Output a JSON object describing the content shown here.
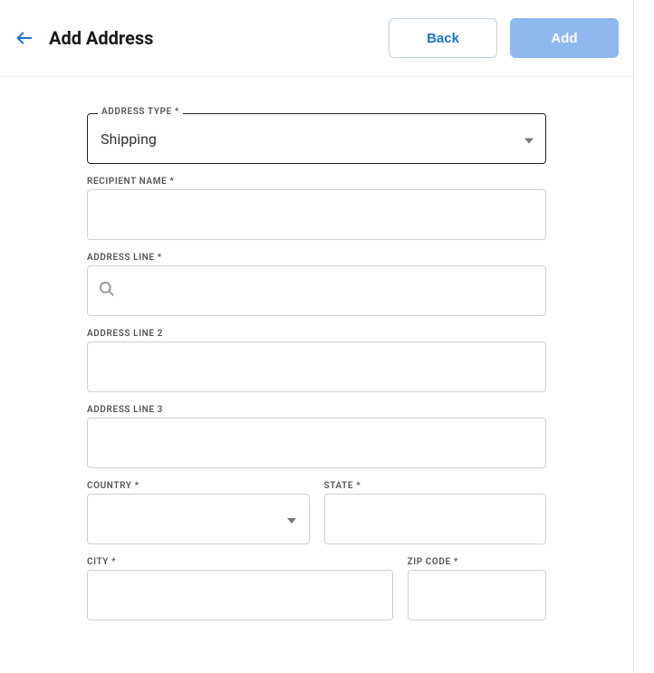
{
  "header": {
    "title": "Add Address",
    "back_label": "Back",
    "add_label": "Add"
  },
  "form": {
    "address_type": {
      "label": "ADDRESS TYPE *",
      "value": "Shipping"
    },
    "recipient_name": {
      "label": "RECIPIENT NAME *",
      "value": ""
    },
    "address_line_1": {
      "label": "ADDRESS LINE *",
      "value": ""
    },
    "address_line_2": {
      "label": "ADDRESS LINE 2",
      "value": ""
    },
    "address_line_3": {
      "label": "ADDRESS LINE 3",
      "value": ""
    },
    "country": {
      "label": "COUNTRY *",
      "value": ""
    },
    "state": {
      "label": "STATE *",
      "value": ""
    },
    "city": {
      "label": "CITY *",
      "value": ""
    },
    "zip": {
      "label": "ZIP CODE *",
      "value": ""
    }
  }
}
